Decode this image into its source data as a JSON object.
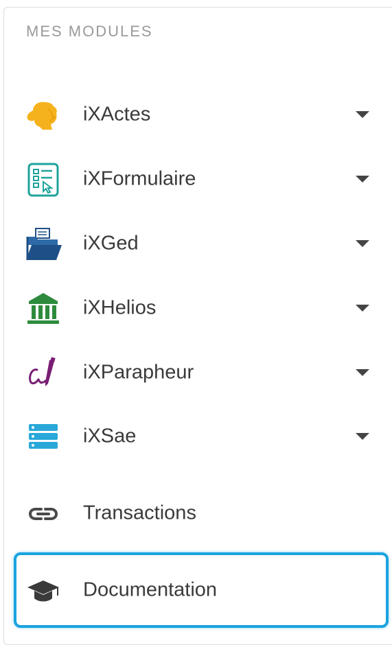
{
  "section_title": "MES MODULES",
  "colors": {
    "actes": "#f5b21c",
    "formulaire": "#1ea39a",
    "ged": "#1e4f86",
    "helios": "#2e8b3d",
    "parapheur": "#7a1e74",
    "sae": "#2aa8d9",
    "highlight": "#1aa3e0"
  },
  "modules": [
    {
      "label": "iXActes",
      "icon": "woman-head-icon"
    },
    {
      "label": "iXFormulaire",
      "icon": "form-checklist-icon"
    },
    {
      "label": "iXGed",
      "icon": "folder-open-icon"
    },
    {
      "label": "iXHelios",
      "icon": "bank-building-icon"
    },
    {
      "label": "iXParapheur",
      "icon": "signature-pen-icon"
    },
    {
      "label": "iXSae",
      "icon": "server-stack-icon"
    }
  ],
  "links": {
    "transactions": {
      "label": "Transactions",
      "icon": "link-icon"
    },
    "documentation": {
      "label": "Documentation",
      "icon": "graduation-cap-icon"
    }
  }
}
